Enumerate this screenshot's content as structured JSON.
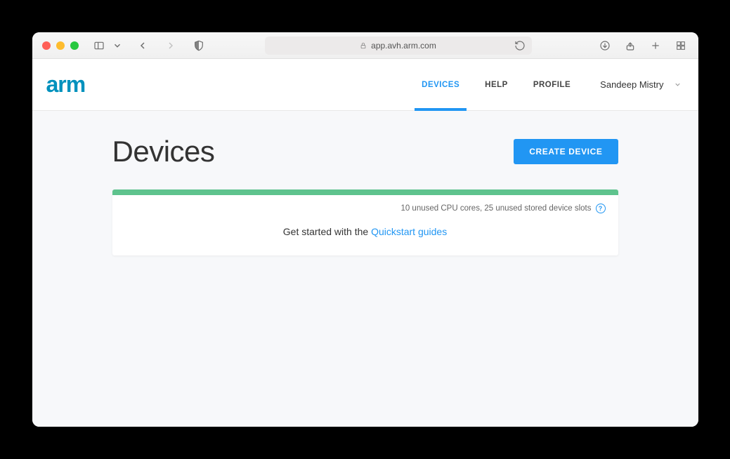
{
  "browser": {
    "url": "app.avh.arm.com"
  },
  "header": {
    "brand": "arm",
    "nav": {
      "devices": "DEVICES",
      "help": "HELP",
      "profile": "PROFILE"
    },
    "user": "Sandeep Mistry"
  },
  "page": {
    "title": "Devices",
    "create_button": "CREATE DEVICE",
    "status_text": "10 unused CPU cores, 25 unused stored device slots",
    "getstarted_prefix": "Get started with the ",
    "getstarted_link": "Quickstart guides"
  }
}
